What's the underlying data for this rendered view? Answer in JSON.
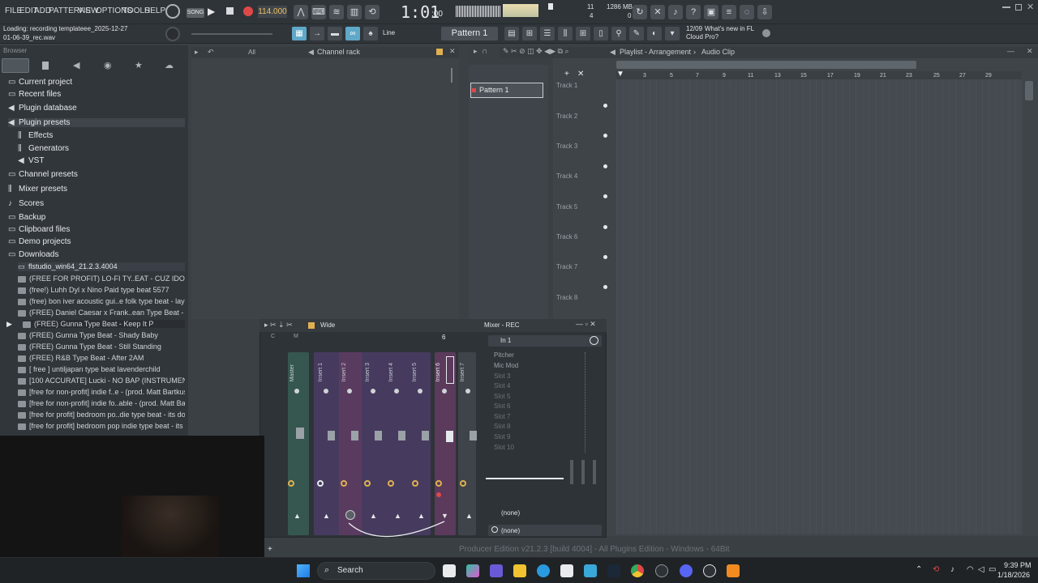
{
  "menu": [
    "FILE",
    "EDIT",
    "ADD",
    "PATTERNS",
    "VIEW",
    "OPTIONS",
    "TOOLS",
    "HELP"
  ],
  "status": {
    "loading_line1": "Loading: recording templateee_2025-12-27",
    "loading_line2": "01-06-39_rec.wav"
  },
  "transport": {
    "song_label": "SONG",
    "tempo": "114.000",
    "time": "1:01",
    "time_sub": ":00",
    "cpu_top": "11",
    "cpu_bottom": "4",
    "memory": "1286 MB",
    "memory_bottom": "0"
  },
  "news": {
    "date": "12/09",
    "line1": "What's new in FL",
    "line2": "Cloud Pro?"
  },
  "toolbar2": {
    "snap": "Line",
    "pattern": "Pattern 1"
  },
  "browser": {
    "title": "Browser",
    "items": [
      {
        "icon": "folder",
        "label": "Current project"
      },
      {
        "icon": "folder",
        "label": "Recent files"
      },
      {
        "icon": "plugin",
        "label": "Plugin database"
      },
      {
        "icon": "plugin",
        "label": "Plugin presets"
      },
      {
        "icon": "effects",
        "label": "Effects"
      },
      {
        "icon": "generators",
        "label": "Generators"
      },
      {
        "icon": "vst",
        "label": "VST"
      },
      {
        "icon": "folder",
        "label": "Channel presets"
      },
      {
        "icon": "mixer",
        "label": "Mixer presets"
      },
      {
        "icon": "note",
        "label": "Scores"
      },
      {
        "icon": "folder",
        "label": "Backup"
      },
      {
        "icon": "folder",
        "label": "Clipboard files"
      },
      {
        "icon": "folder",
        "label": "Demo projects"
      },
      {
        "icon": "folder",
        "label": "Downloads"
      },
      {
        "icon": "folder",
        "label": "flstudio_win64_21.2.3.4004"
      }
    ],
    "files": [
      "(FREE FOR PROFIT) LO-FI TY..EAT - CUZ IDONT EVEN KNOW",
      "(free!) Luhh Dyl x Nino Paid type beat 5577",
      "(free) bon iver  acoustic gui..e folk type beat - laying here",
      "(FREE) Daniel Caesar x Frank..ean Type Beat - Tied To You",
      "(FREE) Gunna Type Beat - Keep It P",
      "(FREE) Gunna Type Beat - Shady Baby",
      "(FREE) Gunna Type Beat - Still Standing",
      "(FREE) R&B Type Beat - After 2AM",
      "[ free ] untiljapan type beat lavenderchild",
      "[100 ACCURATE] Lucki - NO BAP (INSTRUMENTAL)",
      "[free for non-profit] indie f..e  - (prod. Matt Bartkus) (1)",
      "[free for non-profit] indie fo..able  - (prod. Matt Bartkus)",
      "[free for profit] bedroom po..die type beat - its done (1)",
      "[free for profit] bedroom pop  indie type beat - its done"
    ]
  },
  "channel_rack": {
    "filter": "All",
    "title": "Channel rack"
  },
  "pattern_list": {
    "item": "Pattern 1"
  },
  "playlist": {
    "title": "Playlist - Arrangement",
    "clip": "Audio Clip",
    "ruler": [
      "3",
      "5",
      "7",
      "9",
      "11",
      "13",
      "15",
      "17",
      "19",
      "21",
      "23",
      "25",
      "27",
      "29"
    ],
    "tracks": [
      "Track 1",
      "Track 2",
      "Track 3",
      "Track 4",
      "Track 5",
      "Track 6",
      "Track 7",
      "Track 8"
    ]
  },
  "mixer": {
    "view": "Wide",
    "title": "Mixer - REC",
    "input": "In 1",
    "strips": [
      "Master",
      "Insert 1",
      "Insert 2",
      "Insert 3",
      "Insert 4",
      "Insert 5",
      "Insert 6",
      "Insert 7"
    ],
    "numbers": [
      "C",
      "M",
      "1",
      "2",
      "3",
      "4",
      "5",
      "6",
      "7"
    ],
    "slots": [
      "Pitcher",
      "Mic Mod",
      "Slot 3",
      "Slot 4",
      "Slot 5",
      "Slot 6",
      "Slot 7",
      "Slot 8",
      "Slot 9",
      "Slot 10"
    ],
    "out1": "(none)",
    "out2": "(none)"
  },
  "footer": {
    "version": "Producer Edition v21.2.3 [build 4004] - All Plugins Edition - Windows - 64Bit"
  },
  "taskbar": {
    "search": "Search",
    "time": "9:39 PM",
    "date": "1/18/2026"
  }
}
